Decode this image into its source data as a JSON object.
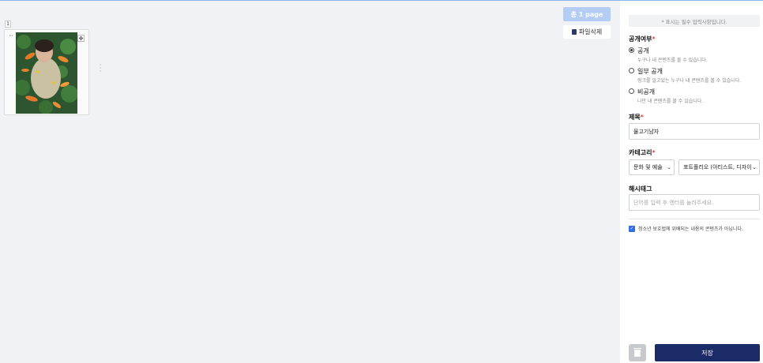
{
  "toolbar": {
    "total_pages_label": "총 1 page",
    "delete_file_label": "파일삭제"
  },
  "pages": [
    {
      "number": "1"
    }
  ],
  "panel": {
    "notice": "* 표시는 필수 입력사항입니다.",
    "visibility": {
      "label": "공개여부",
      "required_mark": "*",
      "options": [
        {
          "title": "공개",
          "desc": "누구나 내 콘텐츠를 볼 수 있습니다.",
          "selected": true
        },
        {
          "title": "일부 공개",
          "desc": "링크를 알고있는 누구나 내 콘텐츠를 볼 수 있습니다.",
          "selected": false
        },
        {
          "title": "비공개",
          "desc": "나만 내 콘텐츠를 볼 수 있습니다.",
          "selected": false
        }
      ]
    },
    "title": {
      "label": "제목",
      "required_mark": "*",
      "value": "물고기남자"
    },
    "category": {
      "label": "카테고리",
      "required_mark": "*",
      "primary_value": "문화 및 예술",
      "secondary_value": "포트폴리오 (아티스트, 디자이"
    },
    "hashtag": {
      "label": "해시태그",
      "placeholder": "단어를 입력 후 엔터를 눌러주세요."
    },
    "youth_check": {
      "label": "청소년 보호법에 위배되는 내용의 콘텐츠가 아닙니다.",
      "checked": true
    },
    "save_label": "저장"
  },
  "colors": {
    "accent": "#1a2b68",
    "total_button": "#b3cdf4",
    "checkbox": "#2f6ee0",
    "required": "#e0473b"
  }
}
